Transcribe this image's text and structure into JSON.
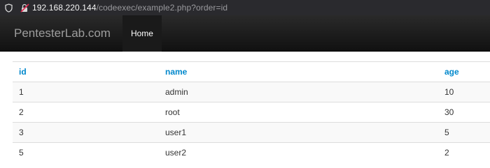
{
  "browser": {
    "url_host": "192.168.220.144",
    "url_path": "/codeexec/example2.php?order=id"
  },
  "navbar": {
    "brand": "PentesterLab.com",
    "home_label": "Home"
  },
  "table": {
    "headers": [
      "id",
      "name",
      "age"
    ],
    "rows": [
      [
        "1",
        "admin",
        "10"
      ],
      [
        "2",
        "root",
        "30"
      ],
      [
        "3",
        "user1",
        "5"
      ],
      [
        "5",
        "user2",
        "2"
      ]
    ]
  },
  "colors": {
    "header_link": "#0088cc",
    "navbar_bg": "#1b1b1b",
    "urlbar_bg": "#2a2a2e"
  }
}
